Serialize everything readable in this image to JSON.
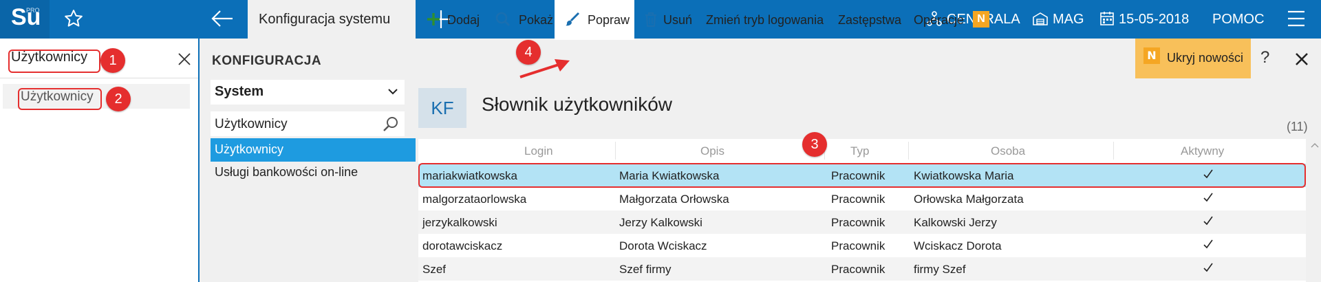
{
  "header": {
    "logo_text": "Su",
    "logo_sup": "PRO",
    "tab_title": "Konfiguracja systemu",
    "centrala": "CENTRALA",
    "mag": "MAG",
    "date": "15-05-2018",
    "help": "POMOC",
    "bg_color": "#0b6fb8"
  },
  "left": {
    "search_value": "Użytkownicy",
    "result": "Użytkownicy"
  },
  "markers": [
    "1",
    "2",
    "3",
    "4"
  ],
  "config": {
    "title": "KONFIGURACJA",
    "section": "System",
    "search_value": "Użytkownicy",
    "items": [
      "Użytkownicy",
      "Usługi bankowości on-line"
    ]
  },
  "toolbar": {
    "add": "Dodaj",
    "show": "Pokaż",
    "edit": "Popraw",
    "delete": "Usuń",
    "login_mode": "Zmień tryb logowania",
    "substitutes": "Zastępstwa",
    "operations": "Operacje",
    "badge": "N",
    "hide_news": "Ukryj nowości",
    "help": "?"
  },
  "page": {
    "icon_text": "KF",
    "title": "Słownik użytkowników",
    "count": "(11)"
  },
  "table": {
    "columns": [
      "Login",
      "Opis",
      "Typ",
      "Osoba",
      "Aktywny"
    ],
    "rows": [
      {
        "login": "mariakwiatkowska",
        "opis": "Maria Kwiatkowska",
        "typ": "Pracownik",
        "osoba": "Kwiatkowska Maria",
        "aktywny": true
      },
      {
        "login": "malgorzataorlowska",
        "opis": "Małgorzata Orłowska",
        "typ": "Pracownik",
        "osoba": "Orłowska Małgorzata",
        "aktywny": true
      },
      {
        "login": "jerzykalkowski",
        "opis": "Jerzy Kalkowski",
        "typ": "Pracownik",
        "osoba": "Kalkowski Jerzy",
        "aktywny": true
      },
      {
        "login": "dorotawciskacz",
        "opis": "Dorota Wciskacz",
        "typ": "Pracownik",
        "osoba": "Wciskacz Dorota",
        "aktywny": true
      },
      {
        "login": "Szef",
        "opis": "Szef firmy",
        "typ": "Pracownik",
        "osoba": "firmy Szef",
        "aktywny": true
      }
    ]
  }
}
